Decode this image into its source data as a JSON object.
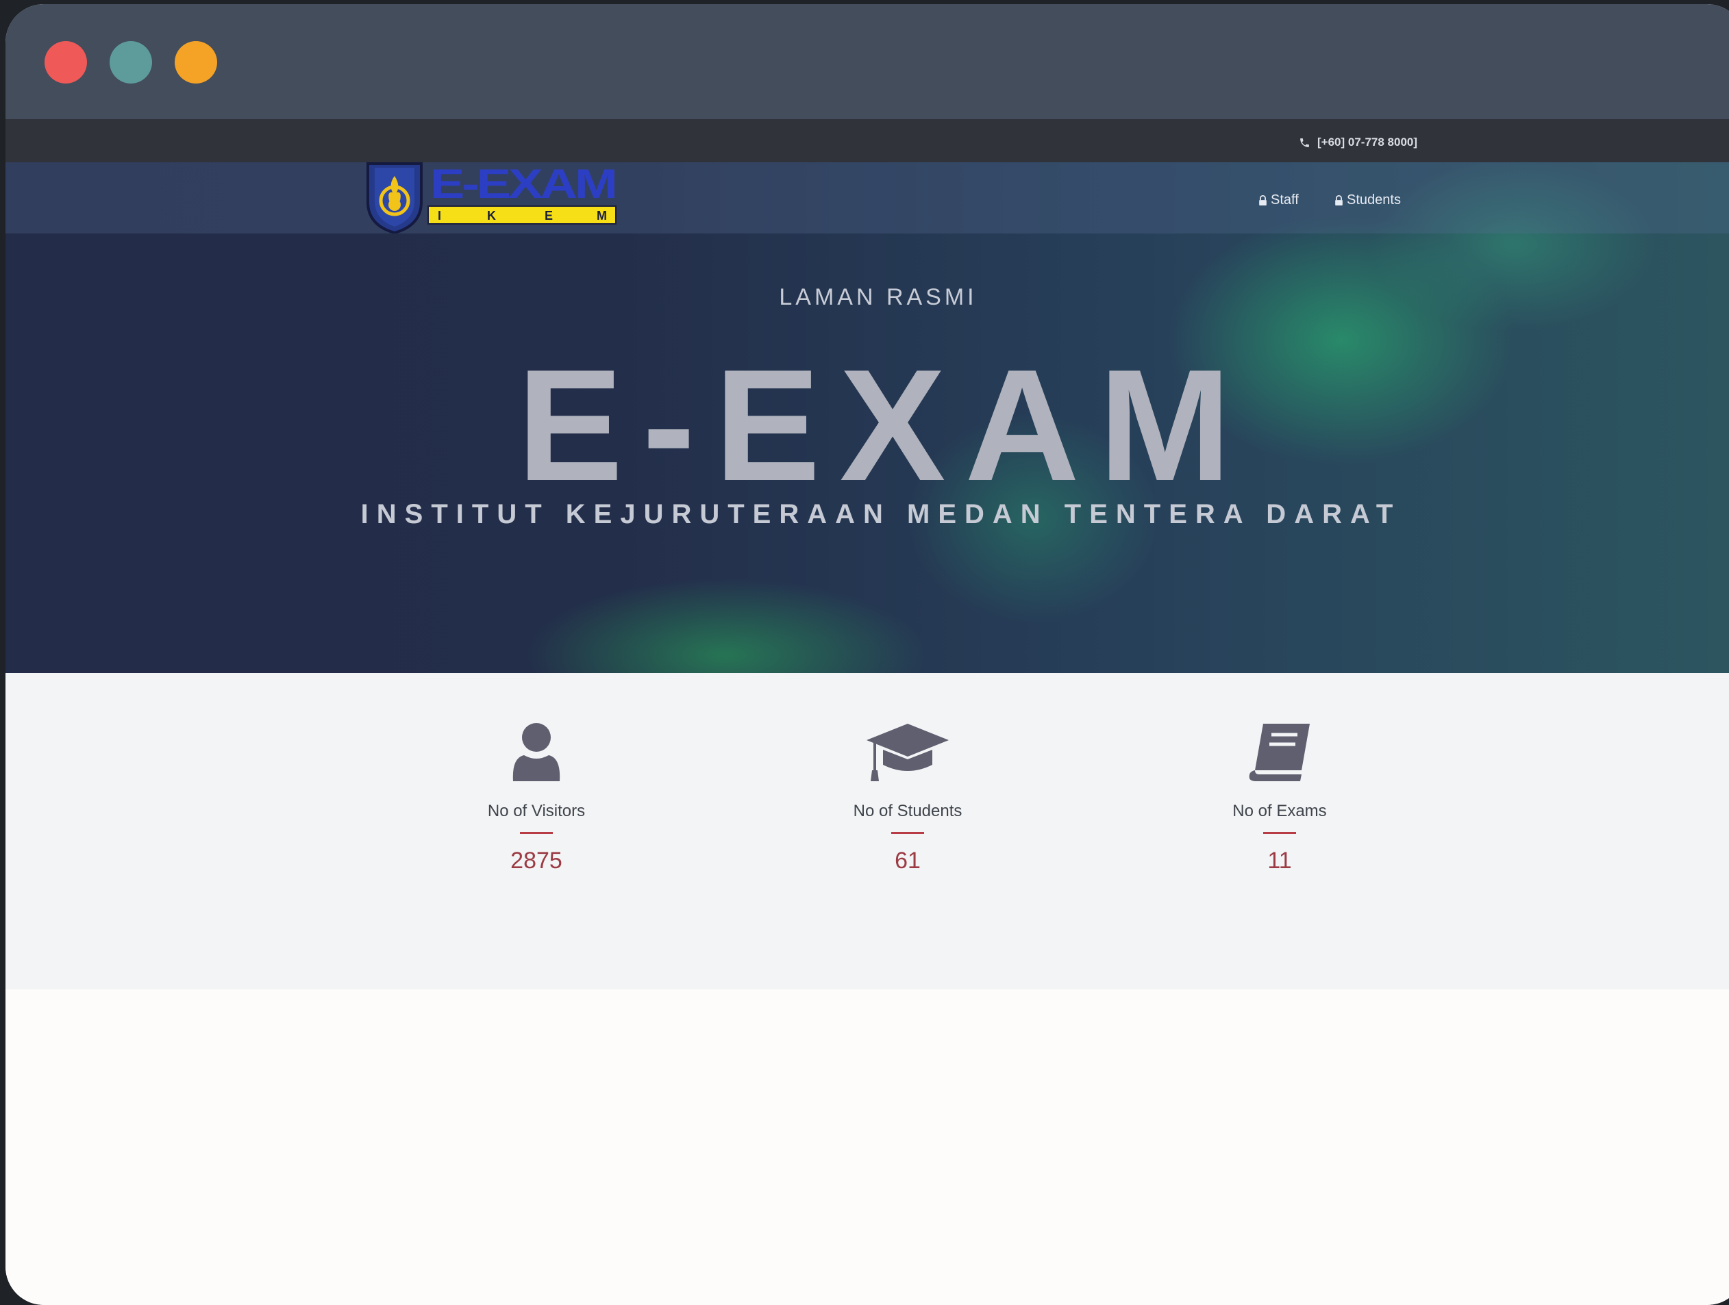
{
  "window": {
    "traffic_lights": [
      "close",
      "minimize",
      "maximize"
    ],
    "colors": {
      "close": "#ef5a58",
      "minimize": "#5e9c9c",
      "maximize": "#f5a327"
    }
  },
  "topbar": {
    "phone_icon": "phone-icon",
    "phone": "[+60] 07-778 8000]"
  },
  "nav": {
    "logo": {
      "title": "E-EXAM",
      "subtitle_letters": [
        "I",
        "K",
        "E",
        "M"
      ]
    },
    "links": [
      {
        "icon": "lock-icon",
        "label": "Staff"
      },
      {
        "icon": "lock-icon",
        "label": "Students"
      }
    ]
  },
  "hero": {
    "kicker": "LAMAN RASMI",
    "title": "E-EXAM",
    "subtitle": "INSTITUT KEJURUTERAAN MEDAN TENTERA DARAT"
  },
  "stats": [
    {
      "icon": "user-icon",
      "label": "No of Visitors",
      "value": "2875"
    },
    {
      "icon": "graduation-cap-icon",
      "label": "No of Students",
      "value": "61"
    },
    {
      "icon": "book-icon",
      "label": "No of Exams",
      "value": "11"
    }
  ],
  "colors": {
    "accent": "#9c3b44",
    "icon": "#5f5f70"
  }
}
